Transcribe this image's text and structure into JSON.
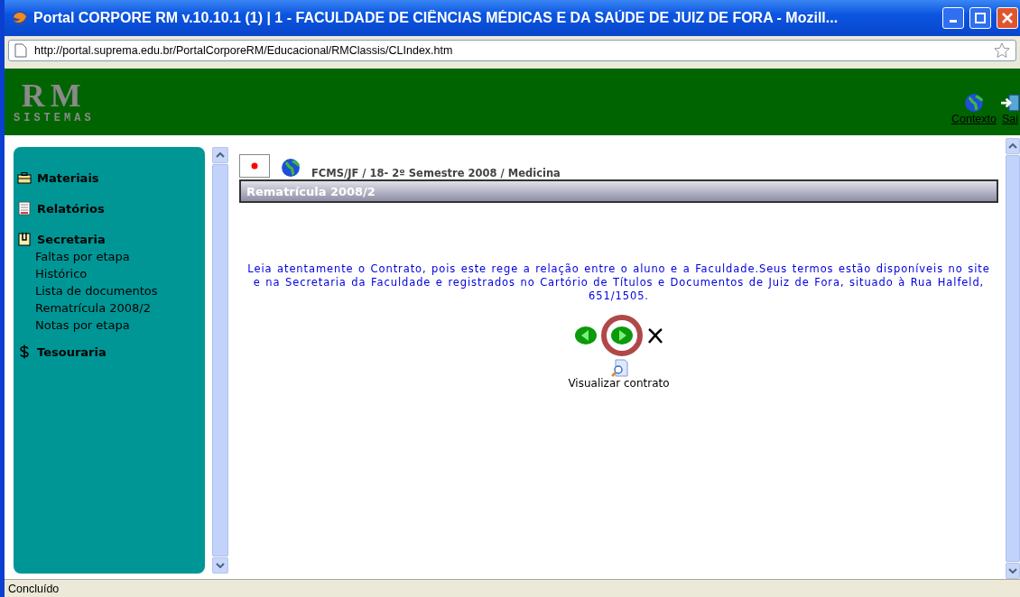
{
  "window": {
    "title": "Portal CORPORE RM v.10.10.1 (1) | 1 - FACULDADE DE CIÊNCIAS MÉDICAS E DA SAÚDE DE JUIZ DE FORA - Mozill..."
  },
  "address_bar": {
    "url": "http://portal.suprema.edu.br/PortalCorporeRM/Educacional/RMClassis/CLIndex.htm"
  },
  "header": {
    "logo_top": "RM",
    "logo_bottom": "SISTEMAS",
    "links": [
      {
        "kind": "globe",
        "label": "Contexto"
      },
      {
        "kind": "exit",
        "label": "Sai"
      }
    ]
  },
  "sidebar": {
    "groups": [
      {
        "kind": "briefcase",
        "label": "Materiais"
      },
      {
        "kind": "report",
        "label": "Relatórios"
      },
      {
        "kind": "clipboard",
        "label": "Secretaria",
        "children": [
          "Faltas por etapa",
          "Histórico",
          "Lista de documentos",
          "Rematrícula 2008/2",
          "Notas por etapa"
        ]
      },
      {
        "kind": "dollar",
        "label": "Tesouraria"
      }
    ]
  },
  "main": {
    "breadcrumb": "FCMS/JF / 18- 2º Semestre 2008  / Medicina",
    "section_title": "Rematrícula 2008/2",
    "message": "Leia atentamente o Contrato, pois este rege a relação entre o aluno e a Faculdade.Seus termos estão disponíveis no site e na Secretaria da Faculdade e registrados no Cartório de Títulos e Documentos de Juiz de Fora, situado à Rua Halfeld, 651/1505.",
    "view_contract": "Visualizar contrato"
  },
  "status_bar": {
    "text": "Concluído"
  }
}
